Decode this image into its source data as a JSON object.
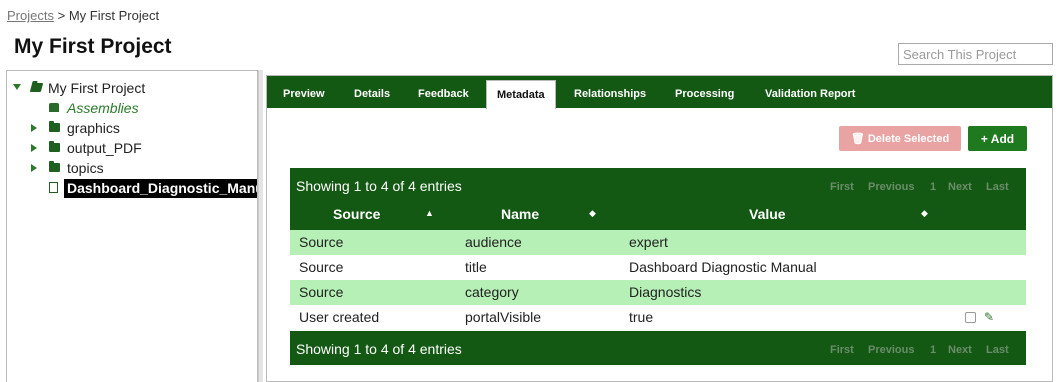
{
  "breadcrumb": {
    "root": "Projects",
    "sep": ">",
    "current": "My First Project"
  },
  "page": {
    "title": "My First Project"
  },
  "search": {
    "placeholder": "Search This Project"
  },
  "tree": {
    "root": "My First Project",
    "assemblies": "Assemblies",
    "folders": [
      "graphics",
      "output_PDF",
      "topics"
    ],
    "selected_doc": "Dashboard_Diagnostic_Manual"
  },
  "tabs": [
    "Preview",
    "Details",
    "Feedback",
    "Metadata",
    "Relationships",
    "Processing",
    "Validation Report"
  ],
  "active_tab": "Metadata",
  "actions": {
    "delete_label": "Delete Selected",
    "add_label": "Add"
  },
  "table": {
    "info": "Showing 1 to 4 of 4 entries",
    "pager": {
      "first": "First",
      "previous": "Previous",
      "page": "1",
      "next": "Next",
      "last": "Last"
    },
    "columns": [
      "Source",
      "Name",
      "Value"
    ],
    "rows": [
      {
        "source": "Source",
        "name": "audience",
        "value": "expert"
      },
      {
        "source": "Source",
        "name": "title",
        "value": "Dashboard Diagnostic Manual"
      },
      {
        "source": "Source",
        "name": "category",
        "value": "Diagnostics"
      },
      {
        "source": "User created",
        "name": "portalVisible",
        "value": "true"
      }
    ]
  },
  "colors": {
    "brand_green": "#135813",
    "row_highlight": "#b6f0b6",
    "delete_disabled": "#eaa3a3",
    "add_green": "#1f7a1f"
  }
}
